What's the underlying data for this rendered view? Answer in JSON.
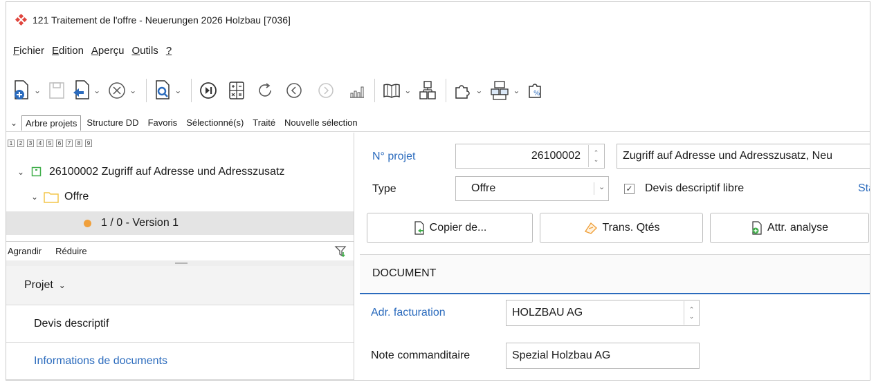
{
  "window": {
    "title": "121 Traitement de l'offre - Neuerungen 2026 Holzbau [7036]"
  },
  "menu": {
    "items": [
      {
        "accel": "F",
        "rest": "ichier"
      },
      {
        "accel": "E",
        "rest": "dition"
      },
      {
        "accel": "A",
        "rest": "perçu"
      },
      {
        "accel": "O",
        "rest": "utils"
      },
      {
        "accel": "?",
        "rest": ""
      }
    ]
  },
  "tabs": [
    "Arbre projets",
    "Structure DD",
    "Favoris",
    "Sélectionné(s)",
    "Traité",
    "Nouvelle sélection"
  ],
  "tree": {
    "levels": [
      "1",
      "2",
      "3",
      "4",
      "5",
      "6",
      "7",
      "8",
      "9"
    ],
    "project_label": "26100002 Zugriff auf Adresse und Adresszusatz",
    "folder_label": "Offre",
    "version_label": "1 / 0 - Version 1"
  },
  "left_actions": {
    "expand": "Agrandir",
    "collapse": "Réduire"
  },
  "nav": {
    "section": "Projet",
    "items": [
      "Devis descriptif",
      "Informations de documents"
    ]
  },
  "form": {
    "project_no_label": "N° projet",
    "project_no_value": "26100002",
    "project_desc": "Zugriff auf Adresse und Adresszusatz, Neu",
    "type_label": "Type",
    "type_value": "Offre",
    "free_spec_label": "Devis descriptif libre",
    "free_spec_checked": true,
    "status_link": "Sta",
    "btn_copy": "Copier de...",
    "btn_trans": "Trans. Qtés",
    "btn_attr": "Attr. analyse",
    "section_title": "DOCUMENT",
    "billing_label": "Adr. facturation",
    "billing_value": "HOLZBAU AG",
    "client_note_label": "Note commanditaire",
    "client_note_value": "Spezial Holzbau AG"
  },
  "colors": {
    "accent": "#2b6bbd",
    "brand": "#e0463e",
    "selection": "#e4e4e4",
    "folder": "#f3c64a",
    "version_dot": "#f0a03c",
    "tree_node": "#3fae49"
  }
}
